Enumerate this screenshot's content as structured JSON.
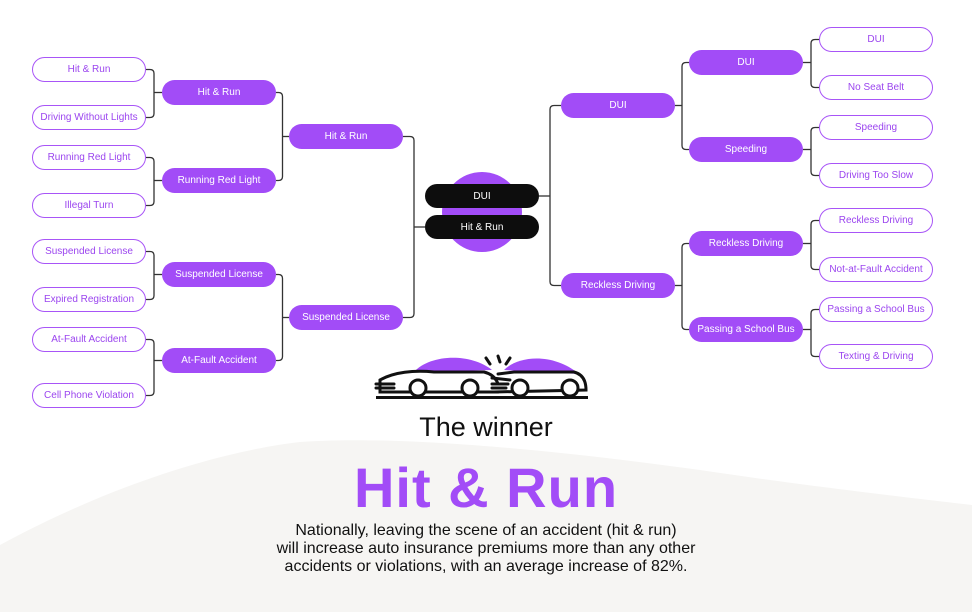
{
  "colors": {
    "accent": "#a24cf7",
    "leaf_border": "#a855f7",
    "final_bg": "#0d0d0d",
    "bg_wave": "#f6f5f3",
    "connector": "#333333"
  },
  "bracket": {
    "left": {
      "round1": [
        "Hit & Run",
        "Driving Without Lights",
        "Running Red Light",
        "Illegal Turn",
        "Suspended License",
        "Expired Registration",
        "At-Fault Accident",
        "Cell Phone Violation"
      ],
      "round2": [
        "Hit & Run",
        "Running Red Light",
        "Suspended License",
        "At-Fault Accident"
      ],
      "round3": [
        "Hit & Run",
        "Suspended License"
      ]
    },
    "right": {
      "round1": [
        "DUI",
        "No Seat Belt",
        "Speeding",
        "Driving Too Slow",
        "Reckless Driving",
        "Not-at-Fault Accident",
        "Passing a School Bus",
        "Texting & Driving"
      ],
      "round2": [
        "DUI",
        "Speeding",
        "Reckless Driving",
        "Passing a School Bus"
      ],
      "round3": [
        "DUI",
        "Reckless Driving"
      ]
    },
    "final": [
      "DUI",
      "Hit & Run"
    ]
  },
  "illustration": "car-crash-icon",
  "result": {
    "label": "The winner",
    "winner": "Hit & Run",
    "description": [
      "Nationally, leaving the scene of an accident (hit & run)",
      "will increase auto insurance premiums more than any other",
      "accidents or violations, with an average increase of 82%."
    ]
  }
}
